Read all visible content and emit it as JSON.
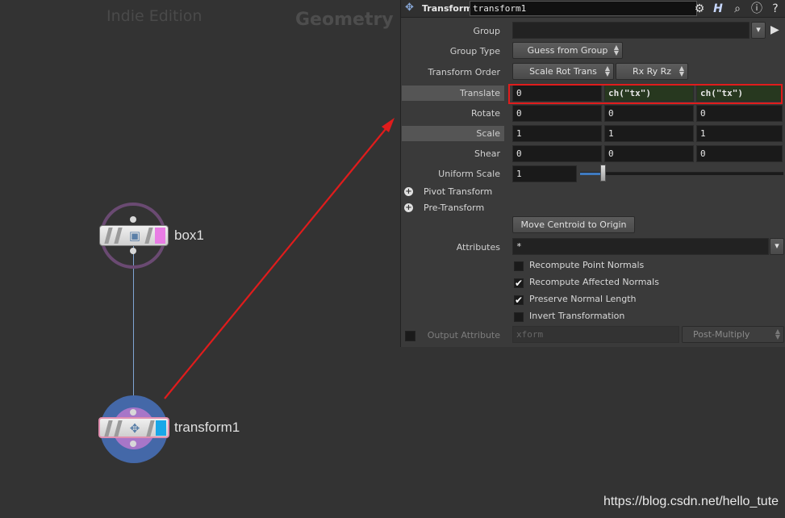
{
  "network": {
    "watermark_left": "Indie Edition",
    "watermark_right": "Geometry",
    "credit": "https://blog.csdn.net/hello_tute",
    "nodes": [
      {
        "name": "box1",
        "icon": "box-icon",
        "flag_color": "#e87ce4"
      },
      {
        "name": "transform1",
        "icon": "transform-icon",
        "flag_color": "#19a7e8"
      }
    ],
    "arrow_color": "#e01c1c"
  },
  "panel": {
    "node_type": "Transform",
    "node_name": "transform1",
    "toolbar_icons": [
      "gear-icon",
      "houdini-help-icon",
      "search-icon",
      "info-icon",
      "help-icon"
    ],
    "group": {
      "label": "Group",
      "value": ""
    },
    "group_type": {
      "label": "Group Type",
      "value": "Guess from Group"
    },
    "transform_order": {
      "label": "Transform Order",
      "value": "Scale Rot Trans",
      "rot_order": "Rx Ry Rz"
    },
    "translate": {
      "label": "Translate",
      "values": [
        "0",
        "ch(\"tx\")",
        "ch(\"tx\")"
      ]
    },
    "rotate": {
      "label": "Rotate",
      "values": [
        "0",
        "0",
        "0"
      ]
    },
    "scale": {
      "label": "Scale",
      "values": [
        "1",
        "1",
        "1"
      ]
    },
    "shear": {
      "label": "Shear",
      "values": [
        "0",
        "0",
        "0"
      ]
    },
    "uniform_scale": {
      "label": "Uniform Scale",
      "value": "1",
      "slider_level": 0.1
    },
    "pivot_transform": "Pivot Transform",
    "pre_transform": "Pre-Transform",
    "move_centroid": "Move Centroid to Origin",
    "attributes": {
      "label": "Attributes",
      "value": "*"
    },
    "checkboxes": [
      {
        "label": "Recompute Point Normals",
        "checked": false
      },
      {
        "label": "Recompute Affected Normals",
        "checked": true
      },
      {
        "label": "Preserve Normal Length",
        "checked": true
      },
      {
        "label": "Invert Transformation",
        "checked": false
      }
    ],
    "output_attribute": {
      "label": "Output Attribute",
      "value": "xform",
      "mode": "Post-Multiply"
    }
  }
}
